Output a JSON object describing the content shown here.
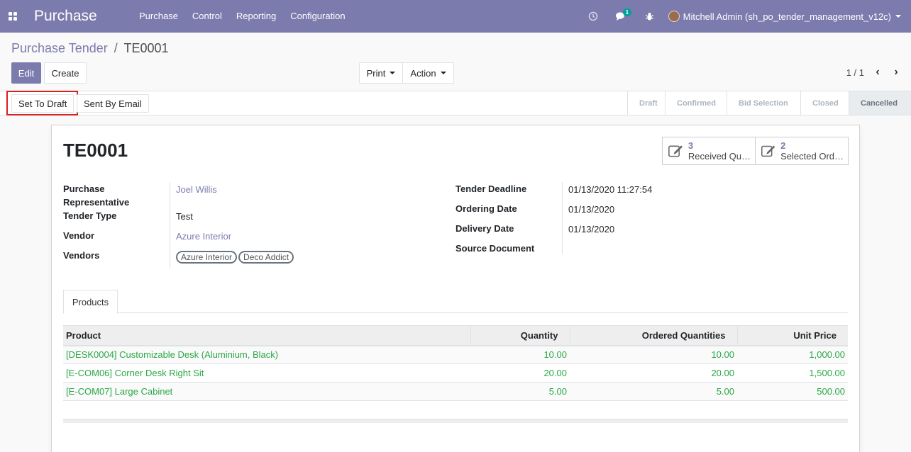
{
  "navbar": {
    "brand": "Purchase",
    "menu": [
      "Purchase",
      "Control",
      "Reporting",
      "Configuration"
    ],
    "chat_badge": "1",
    "user": "Mitchell Admin (sh_po_tender_management_v12c)"
  },
  "breadcrumb": {
    "parent": "Purchase Tender",
    "separator": "/",
    "current": "TE0001"
  },
  "buttons": {
    "edit": "Edit",
    "create": "Create",
    "print": "Print",
    "action": "Action"
  },
  "pager": {
    "value": "1 / 1"
  },
  "statusbar": {
    "buttons": [
      "Set To Draft",
      "Sent By Email"
    ],
    "stages": [
      "Draft",
      "Confirmed",
      "Bid Selection",
      "Closed",
      "Cancelled"
    ],
    "active_stage": "Cancelled"
  },
  "record": {
    "name": "TE0001",
    "smart_buttons": [
      {
        "count": "3",
        "label": "Received Qu…"
      },
      {
        "count": "2",
        "label": "Selected Ord…"
      }
    ],
    "left_fields": {
      "purchase_rep_label_1": "Purchase",
      "purchase_rep_label_2": "Representative",
      "purchase_rep": "Joel Willis",
      "tender_type_label": "Tender Type",
      "tender_type": "Test",
      "vendor_label": "Vendor",
      "vendor": "Azure Interior",
      "vendors_label": "Vendors",
      "vendors": [
        "Azure Interior",
        "Deco Addict"
      ]
    },
    "right_fields": {
      "deadline_label": "Tender Deadline",
      "deadline": "01/13/2020 11:27:54",
      "ordering_label": "Ordering Date",
      "ordering": "01/13/2020",
      "delivery_label": "Delivery Date",
      "delivery": "01/13/2020",
      "source_label": "Source Document",
      "source": ""
    }
  },
  "tabs": [
    "Products"
  ],
  "table": {
    "headers": [
      "Product",
      "Quantity",
      "Ordered Quantities",
      "Unit Price"
    ],
    "rows": [
      [
        "[DESK0004] Customizable Desk (Aluminium, Black)",
        "10.00",
        "10.00",
        "1,000.00"
      ],
      [
        "[E-COM06] Corner Desk Right Sit",
        "20.00",
        "20.00",
        "1,500.00"
      ],
      [
        "[E-COM07] Large Cabinet",
        "5.00",
        "5.00",
        "500.00"
      ]
    ]
  },
  "colors": {
    "brand": "#7c7bad",
    "link_green": "#28a745",
    "highlight_red": "#d9201e"
  },
  "icons": [
    "apps-grid-icon",
    "clock-icon",
    "chat-icon",
    "bug-icon",
    "edit-pencil-icon",
    "chevron-left-icon",
    "chevron-right-icon"
  ]
}
